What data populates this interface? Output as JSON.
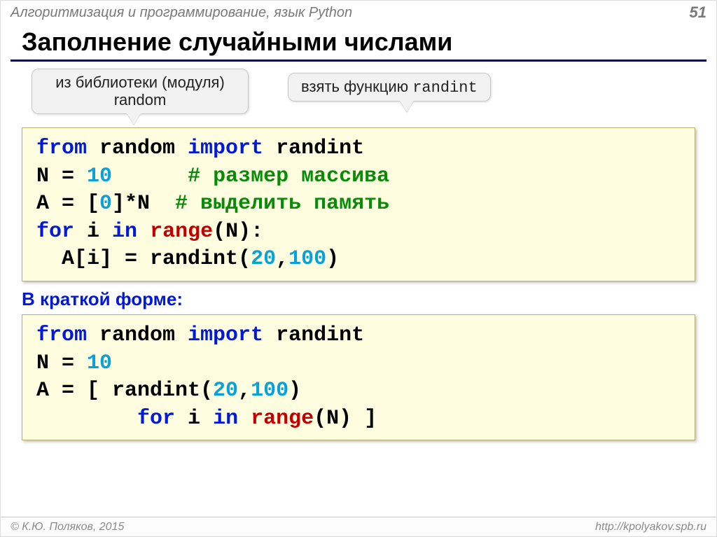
{
  "header": {
    "subject": "Алгоритмизация и программирование, язык Python",
    "page": "51"
  },
  "title": "Заполнение случайными числами",
  "callouts": {
    "left_line1": "из библиотеки (модуля)",
    "left_line2": "random",
    "right_prefix": "взять функцию ",
    "right_fn": "randint"
  },
  "code1": {
    "l1_a": "from",
    "l1_b": " random ",
    "l1_c": "import",
    "l1_d": " randint",
    "l2_a": "N = ",
    "l2_b": "10",
    "l2_c": "      ",
    "l2_d": "# размер массива",
    "l3_a": "A = [",
    "l3_b": "0",
    "l3_c": "]*N  ",
    "l3_d": "# выделить память ",
    "l4_a": "for",
    "l4_b": " i ",
    "l4_c": "in",
    "l4_d": " ",
    "l4_e": "range",
    "l4_f": "(N):",
    "l5_a": "  A[i] = randint(",
    "l5_b": "20",
    "l5_c": ",",
    "l5_d": "100",
    "l5_e": ")"
  },
  "subhead": "В краткой форме:",
  "code2": {
    "l1_a": "from",
    "l1_b": " random ",
    "l1_c": "import",
    "l1_d": " randint",
    "l2_a": "N = ",
    "l2_b": "10",
    "l3_a": "A = [ randint(",
    "l3_b": "20",
    "l3_c": ",",
    "l3_d": "100",
    "l3_e": ") ",
    "l4_a": "        ",
    "l4_b": "for",
    "l4_c": " i ",
    "l4_d": "in",
    "l4_e": " ",
    "l4_f": "range",
    "l4_g": "(N) ]"
  },
  "footer": {
    "left": "© К.Ю. Поляков, 2015",
    "right": "http://kpolyakov.spb.ru"
  }
}
